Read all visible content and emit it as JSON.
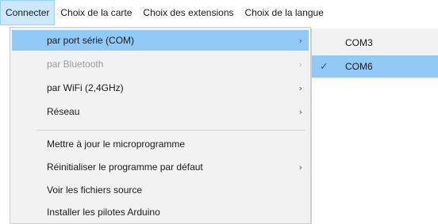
{
  "menubar": {
    "items": [
      {
        "label": "Connecter"
      },
      {
        "label": "Choix de la carte"
      },
      {
        "label": "Choix des extensions"
      },
      {
        "label": "Choix de la langue"
      }
    ]
  },
  "connect_menu": {
    "items": [
      {
        "label": "par port série (COM)",
        "arrow": "›"
      },
      {
        "label": "par Bluetooth",
        "arrow": "›"
      },
      {
        "label": "par WiFi (2,4GHz)",
        "arrow": "›"
      },
      {
        "label": "Réseau",
        "arrow": "›"
      },
      {
        "label": "Mettre à jour le microprogramme"
      },
      {
        "label": "Réinitialiser le programme par défaut",
        "arrow": "›"
      },
      {
        "label": "Voir les fichiers source"
      },
      {
        "label": "Installer les pilotes Arduino"
      }
    ]
  },
  "com_submenu": {
    "items": [
      {
        "label": "COM3"
      },
      {
        "label": "COM6",
        "check": "✓"
      }
    ]
  },
  "colors": {
    "highlight": "#91c9f7",
    "menubar_active": "#cce8ff",
    "check": "#1a5fb4"
  }
}
